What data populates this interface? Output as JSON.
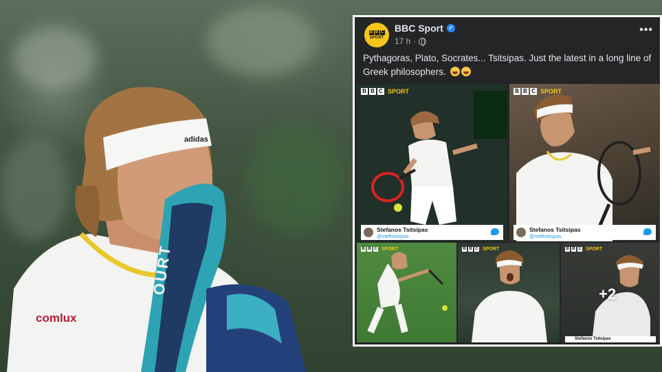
{
  "post": {
    "page_name": "BBC Sport",
    "time": "17 h",
    "separator": "·",
    "text": "Pythagoras, Plato, Socrates... Tsitsipas. Just the latest in a long line of Greek philosophers.",
    "more_menu": "•••"
  },
  "avatar_logo": {
    "letters": [
      "B",
      "B",
      "C"
    ],
    "word": "SPORT"
  },
  "tiles": [
    {
      "badge_letters": [
        "B",
        "B",
        "C"
      ],
      "badge_word": "SPORT",
      "tweet_name": "Stefanos Tsitsipas",
      "tweet_handle": "@steftsitsipas"
    },
    {
      "badge_letters": [
        "B",
        "B",
        "C"
      ],
      "badge_word": "SPORT",
      "tweet_name": "Stefanos Tsitsipas",
      "tweet_handle": "@steftsitsipas"
    },
    {
      "badge_letters": [
        "B",
        "B",
        "C"
      ],
      "badge_word": "SPORT"
    },
    {
      "badge_letters": [
        "B",
        "B",
        "C"
      ],
      "badge_word": "SPORT"
    },
    {
      "badge_letters": [
        "B",
        "B",
        "C"
      ],
      "badge_word": "SPORT",
      "tweet_name": "Stefanos Tsitsipas",
      "more_count": "+2"
    }
  ],
  "background": {
    "headband_brand": "adidas",
    "shirt_sponsor": "comlux",
    "towel_text": "OURT"
  },
  "colors": {
    "bbc_yellow": "#f5c518",
    "fb_dark": "#242526",
    "verified_blue": "#2d88ff",
    "twitter_blue": "#1d9bf0"
  }
}
